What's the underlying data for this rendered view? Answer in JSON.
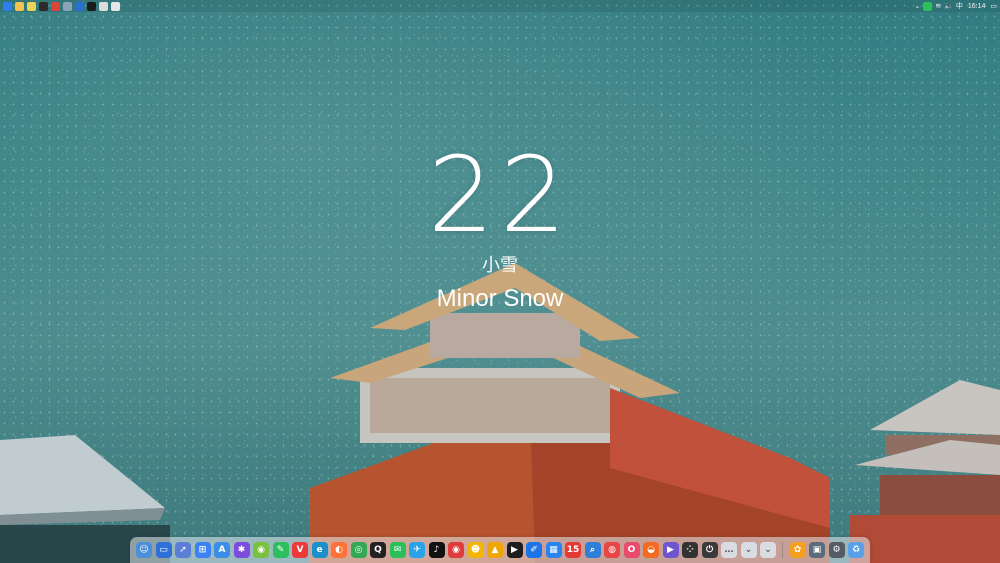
{
  "desktop": {
    "top_panel": {
      "left_apps": [
        {
          "name": "windows-start-icon",
          "color": "#2f80ed"
        },
        {
          "name": "folder-icon",
          "color": "#f2c14e"
        },
        {
          "name": "notes-icon",
          "color": "#e8d35a"
        },
        {
          "name": "terminal-icon",
          "color": "#2b2b2b"
        },
        {
          "name": "chrome-icon",
          "color": "#db4437"
        },
        {
          "name": "picture-icon",
          "color": "#8aa3b8"
        },
        {
          "name": "blue-app-icon",
          "color": "#2b6fd6"
        },
        {
          "name": "media-player-icon",
          "color": "#1b1b1b"
        },
        {
          "name": "screen-icon",
          "color": "#dcdcdc"
        },
        {
          "name": "settings-icon",
          "color": "#e6e6e6"
        }
      ],
      "tray": {
        "chevron": "⌄",
        "wechat_color": "#2bbf5a",
        "wifi": "≋",
        "volume": "🔈",
        "ime": "中",
        "time": "16:14",
        "notification": "▭"
      }
    },
    "weather": {
      "temperature": "22",
      "condition_cn": "小雪",
      "condition_en": "Minor Snow"
    },
    "dock": {
      "items": [
        {
          "name": "finder-icon",
          "color": "#4a90d9",
          "glyph": "☺"
        },
        {
          "name": "desktop-icon",
          "color": "#2e6fd8",
          "glyph": "▭"
        },
        {
          "name": "launchpad-icon",
          "color": "#5b7fd6",
          "glyph": "➚"
        },
        {
          "name": "windows-app-icon",
          "color": "#3b82f6",
          "glyph": "⊞"
        },
        {
          "name": "app-store-icon",
          "color": "#3a8ee6",
          "glyph": "A"
        },
        {
          "name": "purple-app-icon",
          "color": "#7c4ddb",
          "glyph": "✱"
        },
        {
          "name": "green-app-icon",
          "color": "#7ac142",
          "glyph": "◉"
        },
        {
          "name": "evernote-icon",
          "color": "#2dbe60",
          "glyph": "✎"
        },
        {
          "name": "vivaldi-icon",
          "color": "#ef3939",
          "glyph": "V"
        },
        {
          "name": "edge-icon",
          "color": "#1e90c9",
          "glyph": "e"
        },
        {
          "name": "firefox-icon",
          "color": "#ff7139",
          "glyph": "◐"
        },
        {
          "name": "chrome-icon",
          "color": "#34a853",
          "glyph": "◎"
        },
        {
          "name": "qq-icon",
          "color": "#222222",
          "glyph": "Q"
        },
        {
          "name": "wechat-icon",
          "color": "#2bbf5a",
          "glyph": "✉"
        },
        {
          "name": "feishu-icon",
          "color": "#2ba3e8",
          "glyph": "✈"
        },
        {
          "name": "tiktok-icon",
          "color": "#111111",
          "glyph": "♪"
        },
        {
          "name": "netease-music-icon",
          "color": "#e03c3c",
          "glyph": "◉"
        },
        {
          "name": "yellow-app-icon",
          "color": "#f2b705",
          "glyph": "☻"
        },
        {
          "name": "mango-icon",
          "color": "#f0a500",
          "glyph": "▲"
        },
        {
          "name": "infuse-icon",
          "color": "#1e1e1e",
          "glyph": "▶"
        },
        {
          "name": "blue-doc-icon",
          "color": "#1d74e8",
          "glyph": "✐"
        },
        {
          "name": "grid-app-icon",
          "color": "#2a84f0",
          "glyph": "▦"
        },
        {
          "name": "calendar-icon",
          "color": "#e53935",
          "glyph": "15"
        },
        {
          "name": "search-app-icon",
          "color": "#2f7fd8",
          "glyph": "⌕"
        },
        {
          "name": "red-app-icon",
          "color": "#e84545",
          "glyph": "◍"
        },
        {
          "name": "opera-icon",
          "color": "#ea4b6a",
          "glyph": "O"
        },
        {
          "name": "brave-icon",
          "color": "#f26b21",
          "glyph": "◒"
        },
        {
          "name": "purple-video-icon",
          "color": "#6e56cf",
          "glyph": "▶"
        },
        {
          "name": "multi-app-icon",
          "color": "#333333",
          "glyph": "⁘"
        },
        {
          "name": "power-icon",
          "color": "#3a3a3a",
          "glyph": "⏻"
        },
        {
          "name": "more-icon",
          "color": "#d9dde2",
          "glyph": "…"
        },
        {
          "name": "chevron-down-icon",
          "color": "#d9dde2",
          "glyph": "⌄"
        },
        {
          "name": "chevron-down-alt-icon",
          "color": "#d9dde2",
          "glyph": "⌄"
        }
      ],
      "right_items": [
        {
          "name": "photos-icon",
          "color": "#f4a020",
          "glyph": "✿"
        },
        {
          "name": "image-viewer-icon",
          "color": "#5a6b7c",
          "glyph": "▣"
        },
        {
          "name": "system-settings-icon",
          "color": "#555c66",
          "glyph": "⚙"
        },
        {
          "name": "recycle-bin-icon",
          "color": "#5aa0e6",
          "glyph": "♻"
        }
      ]
    }
  }
}
